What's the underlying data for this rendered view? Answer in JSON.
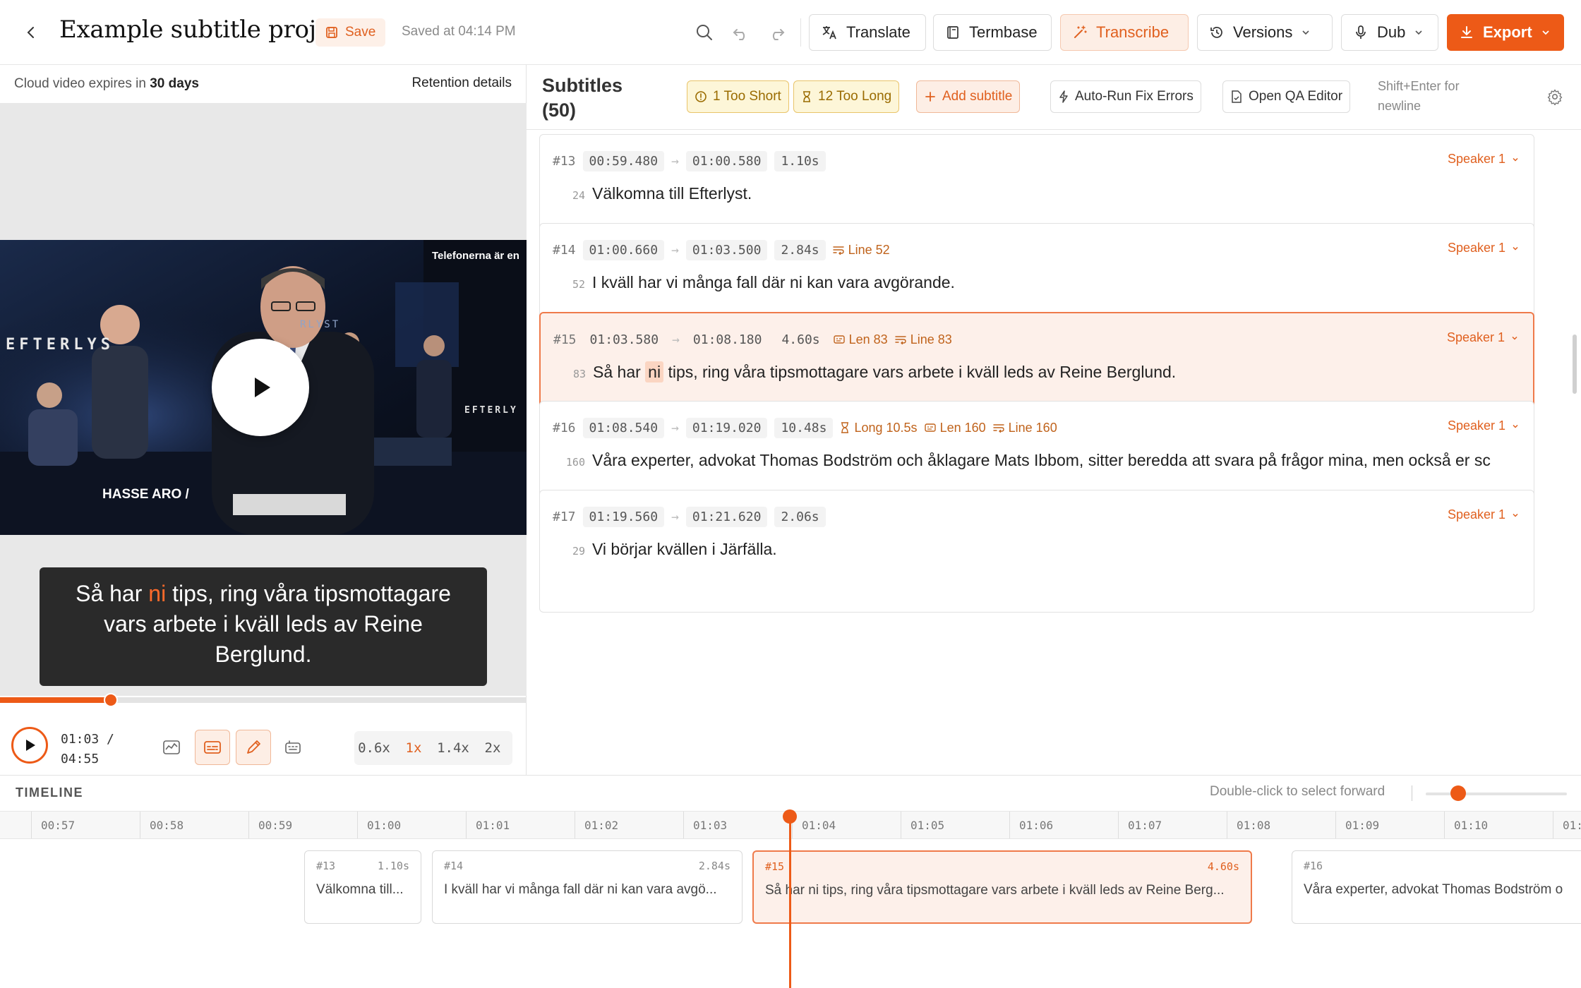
{
  "header": {
    "title": "Example subtitle project",
    "save_label": "Save",
    "saved_at": "Saved at 04:14 PM",
    "buttons": {
      "translate": "Translate",
      "termbase": "Termbase",
      "transcribe": "Transcribe",
      "versions": "Versions",
      "dub": "Dub",
      "export": "Export"
    },
    "accent_color": "#ed5a17"
  },
  "left": {
    "cloud_prefix": "Cloud video expires in",
    "cloud_days": "30 days",
    "retention": "Retention details",
    "frame": {
      "show_name": "EFTERLYS",
      "lower_third": "HASSE ARO /",
      "ticker": "Telefonerna är en",
      "screen_logo": "EFTERLY",
      "backdrop_text": "RLYST"
    },
    "caption": {
      "before": "Så har ",
      "highlight": "ni",
      "after": " tips, ring våra tipsmottagare vars arbete i kväll leds av Reine Berglund."
    },
    "progress": 0.21,
    "time_current": "01:03 /",
    "time_total": "04:55",
    "speeds": [
      "0.6x",
      "1x",
      "1.4x",
      "2x"
    ],
    "speed_selected": "1x"
  },
  "subtitles": {
    "title_line1": "Subtitles",
    "title_line2": "(50)",
    "too_short": "1 Too Short",
    "too_long": "12 Too Long",
    "add": "Add subtitle",
    "autorun": "Auto-Run Fix Errors",
    "qa": "Open QA Editor",
    "hint_line1": "Shift+Enter for",
    "hint_line2": "newline",
    "items": [
      {
        "id": "#13",
        "start": "00:59.480",
        "end": "01:00.580",
        "dur": "1.10s",
        "issues": [],
        "speaker": "Speaker 1",
        "count": "24",
        "text": "Välkomna till Efterlyst."
      },
      {
        "id": "#14",
        "start": "01:00.660",
        "end": "01:03.500",
        "dur": "2.84s",
        "issues": [
          {
            "icon": "lines-icon",
            "label": "Line 52"
          }
        ],
        "speaker": "Speaker 1",
        "count": "52",
        "text": "I kväll har vi många fall där ni kan vara avgörande."
      },
      {
        "id": "#15",
        "start": "01:03.580",
        "end": "01:08.180",
        "dur": "4.60s",
        "issues": [
          {
            "icon": "length-icon",
            "label": "Len 83"
          },
          {
            "icon": "lines-icon",
            "label": "Line 83"
          }
        ],
        "speaker": "Speaker 1",
        "count": "83",
        "text_before": "Så har ",
        "text_highlight": "ni",
        "text_after": " tips, ring våra tipsmottagare vars arbete i kväll leds av Reine Berglund."
      },
      {
        "id": "#16",
        "start": "01:08.540",
        "end": "01:19.020",
        "dur": "10.48s",
        "issues": [
          {
            "icon": "hourglass-icon",
            "label": "Long 10.5s"
          },
          {
            "icon": "length-icon",
            "label": "Len 160"
          },
          {
            "icon": "lines-icon",
            "label": "Line 160"
          }
        ],
        "speaker": "Speaker 1",
        "count": "160",
        "text": "Våra experter, advokat Thomas Bodström och åklagare Mats Ibbom, sitter beredda att svara på frågor mina, men också er sc"
      },
      {
        "id": "#17",
        "start": "01:19.560",
        "end": "01:21.620",
        "dur": "2.06s",
        "issues": [],
        "speaker": "Speaker 1",
        "count": "29",
        "text": "Vi börjar kvällen i Järfälla."
      }
    ]
  },
  "timeline": {
    "label": "TIMELINE",
    "hint": "Double-click to select forward",
    "zoom": 0.23,
    "ticks": [
      "00:57",
      "00:58",
      "00:59",
      "01:00",
      "01:01",
      "01:02",
      "01:03",
      "01:04",
      "01:05",
      "01:06",
      "01:07",
      "01:08",
      "01:09",
      "01:10",
      "01:1"
    ],
    "segments": [
      {
        "id": "#13",
        "dur": "1.10s",
        "text": "Välkomna till..."
      },
      {
        "id": "#14",
        "dur": "2.84s",
        "text": "I kväll har vi många fall där ni kan vara avgö..."
      },
      {
        "id": "#15",
        "dur": "4.60s",
        "text": "Så har ni tips, ring våra tipsmottagare vars arbete i kväll leds av Reine Berg..."
      },
      {
        "id": "#16",
        "dur": "",
        "text": "Våra experter, advokat Thomas Bodström o"
      }
    ]
  }
}
